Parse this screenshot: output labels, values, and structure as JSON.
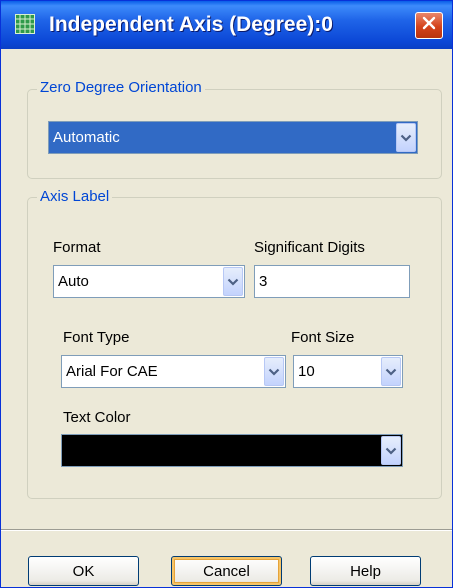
{
  "window": {
    "title": "Independent Axis (Degree):0"
  },
  "zero_degree": {
    "legend": "Zero Degree Orientation",
    "value": "Automatic"
  },
  "axis_label": {
    "legend": "Axis Label",
    "format_label": "Format",
    "format_value": "Auto",
    "digits_label": "Significant Digits",
    "digits_value": "3",
    "font_type_label": "Font Type",
    "font_type_value": "Arial For CAE",
    "font_size_label": "Font Size",
    "font_size_value": "10",
    "text_color_label": "Text Color",
    "text_color_value": "#000000"
  },
  "buttons": {
    "ok": "OK",
    "cancel": "Cancel",
    "help": "Help"
  },
  "colors": {
    "titlebar": "#0b47d6",
    "legend_text": "#0046d5",
    "selection": "#316ac5",
    "close": "#d4431c"
  }
}
